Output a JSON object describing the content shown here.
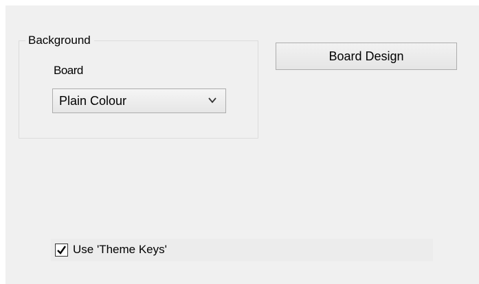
{
  "background_group": {
    "title": "Background",
    "board_label": "Board",
    "board_select": {
      "selected": "Plain Colour"
    }
  },
  "board_design_button": {
    "label": "Board Design"
  },
  "theme_keys": {
    "label": "Use 'Theme Keys'",
    "checked": true
  },
  "icons": {
    "dropdown": "chevron-down-icon",
    "checkmark": "checkmark-icon"
  }
}
